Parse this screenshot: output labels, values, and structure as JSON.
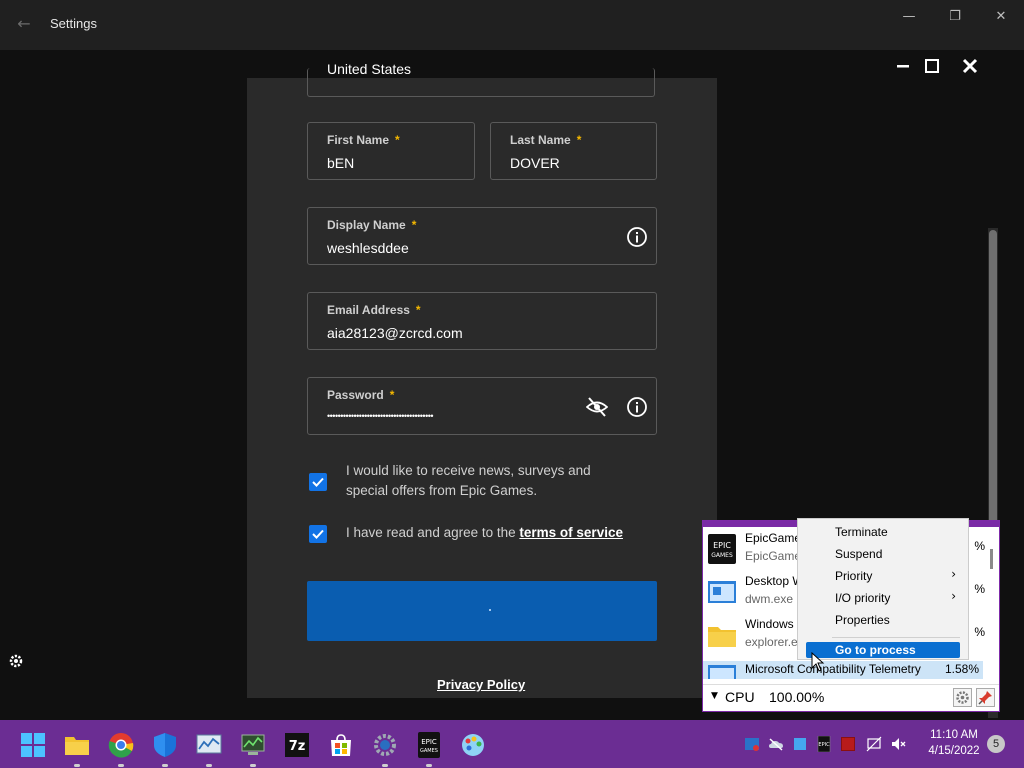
{
  "window": {
    "title": "Settings"
  },
  "form": {
    "country_value": "United States",
    "first_name": {
      "label": "First Name",
      "value": "bEN"
    },
    "last_name": {
      "label": "Last Name",
      "value": "DOVER"
    },
    "display_name": {
      "label": "Display Name",
      "value": "weshlesddee"
    },
    "email": {
      "label": "Email Address",
      "value": "aia28123@zcrcd.com"
    },
    "password": {
      "label": "Password",
      "value": "••••••••••••••••••••••••••••••••••••••••"
    },
    "required_mark": "*",
    "news_checkbox": {
      "line1": "I would like to receive news, surveys and",
      "line2": "special offers from Epic Games.",
      "checked": true
    },
    "tos_checkbox": {
      "text": "I have read and agree to the",
      "link": "terms of service",
      "checked": true
    },
    "privacy_link": "Privacy Policy"
  },
  "process_popup": {
    "items": [
      {
        "name": "EpicGame",
        "exe": "EpicGame",
        "pct": "%",
        "icon": "epic-games-icon"
      },
      {
        "name": "Desktop W",
        "exe": "dwm.exe",
        "pct": "%",
        "icon": "desktop-window-icon"
      },
      {
        "name": "Windows",
        "exe": "explorer.e",
        "pct": "%",
        "icon": "folder-icon"
      }
    ],
    "selected": {
      "name": "Microsoft Compatibility Telemetry",
      "pct": "1.58%"
    },
    "footer": {
      "metric": "CPU",
      "value": "100.00%"
    }
  },
  "context_menu": {
    "items": [
      "Terminate",
      "Suspend",
      "Priority",
      "I/O priority",
      "Properties"
    ],
    "highlighted": "Go to process",
    "submenu_arrow": "›"
  },
  "taskbar": {
    "apps": [
      "start-icon",
      "file-explorer-icon",
      "chrome-icon",
      "defender-icon",
      "resource-monitor-icon",
      "system-monitor-icon",
      "7zip-icon",
      "store-icon",
      "settings-icon",
      "epic-games-icon",
      "paint-icon"
    ],
    "time": "11:10 AM",
    "date": "4/15/2022",
    "notification_count": "5"
  },
  "colors": {
    "taskbar": "#6b2d93",
    "accent_blue": "#1273e6",
    "submit_blue": "#0a5db0",
    "required": "#f5b800"
  }
}
